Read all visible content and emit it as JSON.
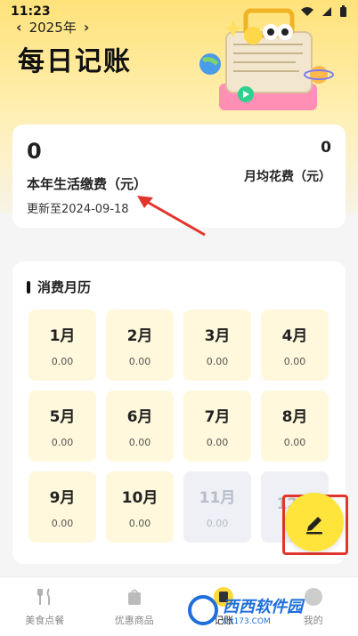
{
  "status": {
    "time": "11:23"
  },
  "header": {
    "year": "2025年",
    "title": "每日记账"
  },
  "summary": {
    "total_value": "0",
    "total_label": "本年生活缴费（元）",
    "updated": "更新至2024-09-18",
    "avg_value": "0",
    "avg_label": "月均花费（元）"
  },
  "calendar": {
    "title": "消费月历",
    "months": [
      {
        "label": "1月",
        "value": "0.00"
      },
      {
        "label": "2月",
        "value": "0.00"
      },
      {
        "label": "3月",
        "value": "0.00"
      },
      {
        "label": "4月",
        "value": "0.00"
      },
      {
        "label": "5月",
        "value": "0.00"
      },
      {
        "label": "6月",
        "value": "0.00"
      },
      {
        "label": "7月",
        "value": "0.00"
      },
      {
        "label": "8月",
        "value": "0.00"
      },
      {
        "label": "9月",
        "value": "0.00"
      },
      {
        "label": "10月",
        "value": "0.00"
      },
      {
        "label": "11月",
        "value": "0.00"
      },
      {
        "label": "12月",
        "value": ""
      }
    ]
  },
  "tabbar": {
    "items": [
      {
        "label": "美食点餐",
        "icon": "fork-knife-icon"
      },
      {
        "label": "优惠商品",
        "icon": "shopping-bag-icon"
      },
      {
        "label": "记账",
        "icon": "ledger-icon"
      },
      {
        "label": "我的",
        "icon": "profile-icon"
      }
    ]
  },
  "watermark": {
    "text": "西西软件园",
    "sub": "CR173.COM"
  },
  "colors": {
    "accent": "#ffe53b",
    "highlight": "#e2352e",
    "month_bg": "#fff8dc"
  }
}
